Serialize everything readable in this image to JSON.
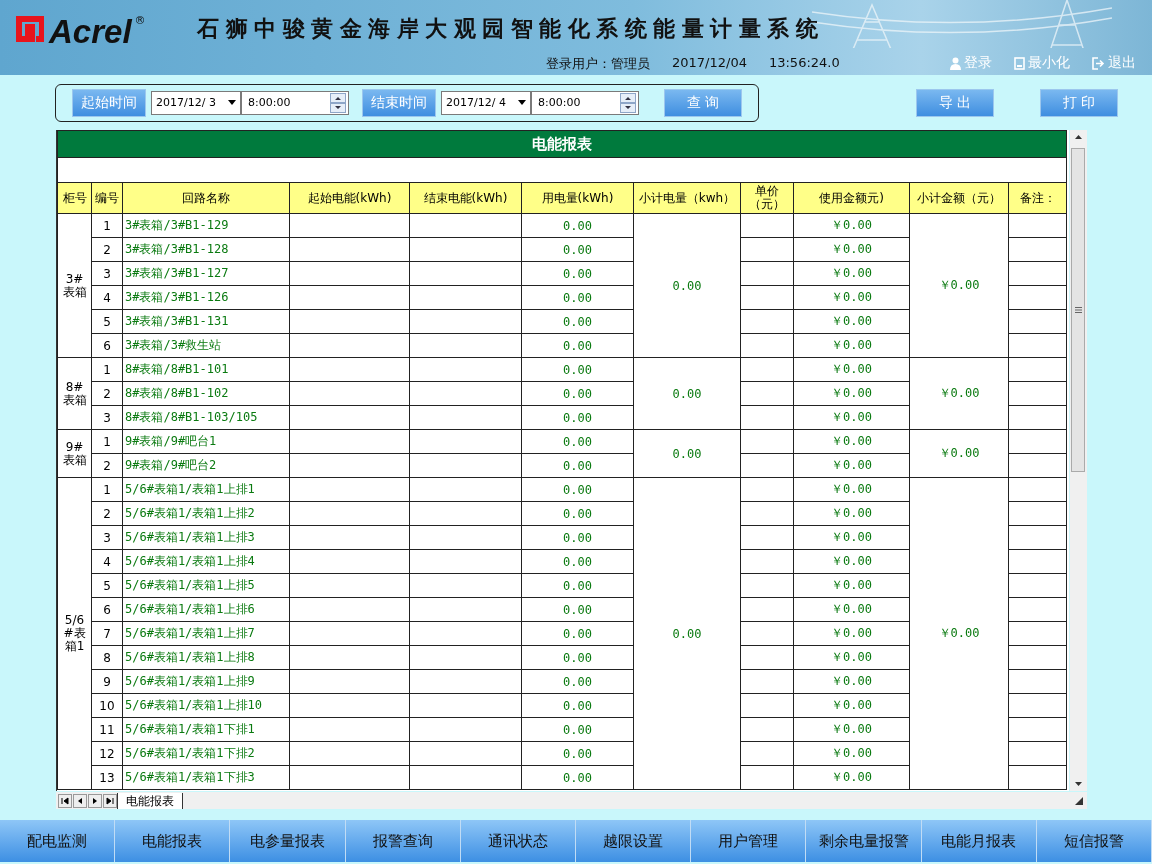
{
  "header": {
    "logo": "Acrel",
    "logo_mark": "®",
    "title": "石狮中骏黄金海岸大观园智能化系统能量计量系统",
    "user_label": "登录用户：管理员",
    "date": "2017/12/04",
    "time": "13:56:24.0",
    "actions": [
      "登录",
      "最小化",
      "退出"
    ]
  },
  "query": {
    "start_label": "起始时间",
    "start_date": "2017/12/ 3",
    "start_time": "8:00:00",
    "end_label": "结束时间",
    "end_date": "2017/12/ 4",
    "end_time": "8:00:00",
    "search": "查 询",
    "export": "导 出",
    "print": "打 印"
  },
  "report": {
    "title": "电能报表",
    "columns": [
      "柜号",
      "编号",
      "回路名称",
      "起始电能(kWh)",
      "结束电能(kWh)",
      "用电量(kWh)",
      "小计电量（kwh）",
      "单价（元）",
      "使用金额元)",
      "小计金额（元）",
      "备注："
    ],
    "groups": [
      {
        "cabinet": "3#表箱",
        "subtotal_energy": "0.00",
        "subtotal_amount": "￥0.00",
        "rows": [
          {
            "no": "1",
            "circuit": "3#表箱/3#B1-129",
            "usage": "0.00",
            "amount": "￥0.00"
          },
          {
            "no": "2",
            "circuit": "3#表箱/3#B1-128",
            "usage": "0.00",
            "amount": "￥0.00"
          },
          {
            "no": "3",
            "circuit": "3#表箱/3#B1-127",
            "usage": "0.00",
            "amount": "￥0.00"
          },
          {
            "no": "4",
            "circuit": "3#表箱/3#B1-126",
            "usage": "0.00",
            "amount": "￥0.00"
          },
          {
            "no": "5",
            "circuit": "3#表箱/3#B1-131",
            "usage": "0.00",
            "amount": "￥0.00"
          },
          {
            "no": "6",
            "circuit": "3#表箱/3#救生站",
            "usage": "0.00",
            "amount": "￥0.00"
          }
        ]
      },
      {
        "cabinet": "8#表箱",
        "subtotal_energy": "0.00",
        "subtotal_amount": "￥0.00",
        "rows": [
          {
            "no": "1",
            "circuit": "8#表箱/8#B1-101",
            "usage": "0.00",
            "amount": "￥0.00"
          },
          {
            "no": "2",
            "circuit": "8#表箱/8#B1-102",
            "usage": "0.00",
            "amount": "￥0.00"
          },
          {
            "no": "3",
            "circuit": "8#表箱/8#B1-103/105",
            "usage": "0.00",
            "amount": "￥0.00"
          }
        ]
      },
      {
        "cabinet": "9#表箱",
        "subtotal_energy": "0.00",
        "subtotal_amount": "￥0.00",
        "rows": [
          {
            "no": "1",
            "circuit": "9#表箱/9#吧台1",
            "usage": "0.00",
            "amount": "￥0.00"
          },
          {
            "no": "2",
            "circuit": "9#表箱/9#吧台2",
            "usage": "0.00",
            "amount": "￥0.00"
          }
        ]
      },
      {
        "cabinet": "5/6#表箱1",
        "subtotal_energy": "0.00",
        "subtotal_amount": "￥0.00",
        "rows": [
          {
            "no": "1",
            "circuit": "5/6#表箱1/表箱1上排1",
            "usage": "0.00",
            "amount": "￥0.00"
          },
          {
            "no": "2",
            "circuit": "5/6#表箱1/表箱1上排2",
            "usage": "0.00",
            "amount": "￥0.00"
          },
          {
            "no": "3",
            "circuit": "5/6#表箱1/表箱1上排3",
            "usage": "0.00",
            "amount": "￥0.00"
          },
          {
            "no": "4",
            "circuit": "5/6#表箱1/表箱1上排4",
            "usage": "0.00",
            "amount": "￥0.00"
          },
          {
            "no": "5",
            "circuit": "5/6#表箱1/表箱1上排5",
            "usage": "0.00",
            "amount": "￥0.00"
          },
          {
            "no": "6",
            "circuit": "5/6#表箱1/表箱1上排6",
            "usage": "0.00",
            "amount": "￥0.00"
          },
          {
            "no": "7",
            "circuit": "5/6#表箱1/表箱1上排7",
            "usage": "0.00",
            "amount": "￥0.00"
          },
          {
            "no": "8",
            "circuit": "5/6#表箱1/表箱1上排8",
            "usage": "0.00",
            "amount": "￥0.00"
          },
          {
            "no": "9",
            "circuit": "5/6#表箱1/表箱1上排9",
            "usage": "0.00",
            "amount": "￥0.00"
          },
          {
            "no": "10",
            "circuit": "5/6#表箱1/表箱1上排10",
            "usage": "0.00",
            "amount": "￥0.00"
          },
          {
            "no": "11",
            "circuit": "5/6#表箱1/表箱1下排1",
            "usage": "0.00",
            "amount": "￥0.00"
          },
          {
            "no": "12",
            "circuit": "5/6#表箱1/表箱1下排2",
            "usage": "0.00",
            "amount": "￥0.00"
          },
          {
            "no": "13",
            "circuit": "5/6#表箱1/表箱1下排3",
            "usage": "0.00",
            "amount": "￥0.00"
          }
        ]
      }
    ]
  },
  "sheet_tabs": [
    {
      "label": "电能报表",
      "selected": true
    }
  ],
  "nav": [
    "配电监测",
    "电能报表",
    "电参量报表",
    "报警查询",
    "通讯状态",
    "越限设置",
    "用户管理",
    "剩余电量报警",
    "电能月报表",
    "短信报警"
  ]
}
